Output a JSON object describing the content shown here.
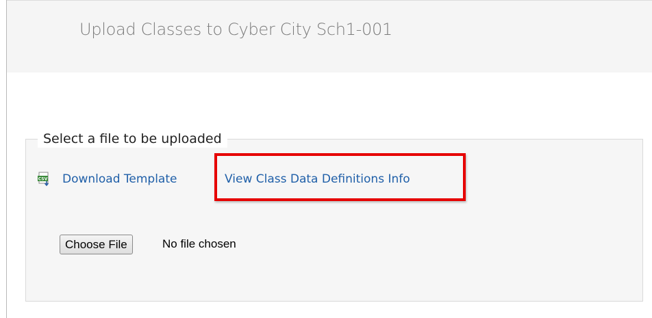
{
  "header": {
    "title": "Upload Classes to Cyber City Sch1-001"
  },
  "upload_section": {
    "legend": "Select a file to be uploaded",
    "template_icon": "csv-file-icon",
    "download_template_label": "Download Template",
    "view_definitions_label": "View Class Data Definitions Info",
    "file_input": {
      "button_label": "Choose File",
      "status": "No file chosen"
    }
  },
  "colors": {
    "link": "#1f5fa8",
    "highlight": "#e60000",
    "header_bg": "#f5f5f5",
    "panel_bg": "#f6f6f6"
  }
}
